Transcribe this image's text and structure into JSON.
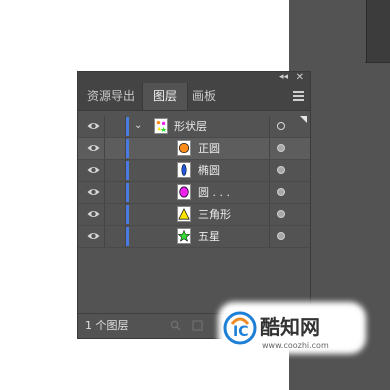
{
  "panel": {
    "collapse_icon": "double-chevron-left",
    "close_icon": "close-x",
    "tabs": [
      {
        "label": "资源导出"
      },
      {
        "label": "图层"
      },
      {
        "label": "画板"
      }
    ],
    "active_tab": "图层",
    "accent_color": "#4a7be0",
    "layer": {
      "label": "形状层",
      "expanded": true
    },
    "objects": [
      {
        "label": "正圆",
        "shape": "circle",
        "fill": "#ff8c1a",
        "selected": true
      },
      {
        "label": "椭圆",
        "shape": "ellipse",
        "fill": "#2255dd",
        "selected": false
      },
      {
        "label": "圆 . . .",
        "shape": "circle",
        "fill": "#ee22ee",
        "selected": false
      },
      {
        "label": "三角形",
        "shape": "triangle",
        "fill": "#ffe600",
        "selected": false
      },
      {
        "label": "五星",
        "shape": "star",
        "fill": "#33dd33",
        "selected": false
      }
    ],
    "footer": {
      "layer_count": "1 个图层"
    }
  },
  "watermark": {
    "brand": "酷知网",
    "url": "www.coozhi.com"
  }
}
